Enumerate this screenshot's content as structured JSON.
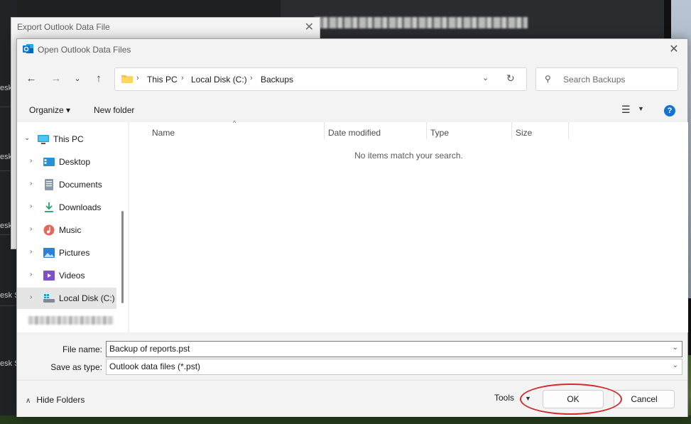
{
  "background": {
    "left_labels": [
      "esk",
      "esk",
      "esk",
      "esk S",
      "esk S"
    ]
  },
  "export_window": {
    "title": "Export Outlook Data File",
    "close_glyph": "✕"
  },
  "dialog": {
    "title": "Open Outlook Data Files",
    "app_icon": "outlook-icon",
    "close_glyph": "✕"
  },
  "nav": {
    "back_glyph": "←",
    "forward_glyph": "→",
    "recent_glyph": "⌄",
    "up_glyph": "↑",
    "breadcrumbs": [
      "This PC",
      "Local Disk (C:)",
      "Backups"
    ],
    "breadcrumb_separator": "›",
    "dropdown_glyph": "⌄",
    "refresh_glyph": "↻"
  },
  "search": {
    "placeholder": "Search Backups",
    "icon_glyph": "⚲"
  },
  "toolbar": {
    "organize_label": "Organize ▾",
    "new_folder_label": "New folder",
    "view_glyph": "☰",
    "view_dropdown_glyph": "▼",
    "help_glyph": "?"
  },
  "tree": {
    "items": [
      {
        "label": "This PC",
        "icon": "computer-icon",
        "expanded": true
      },
      {
        "label": "Desktop",
        "icon": "desktop-icon"
      },
      {
        "label": "Documents",
        "icon": "documents-icon"
      },
      {
        "label": "Downloads",
        "icon": "downloads-icon"
      },
      {
        "label": "Music",
        "icon": "music-icon"
      },
      {
        "label": "Pictures",
        "icon": "pictures-icon"
      },
      {
        "label": "Videos",
        "icon": "videos-icon"
      },
      {
        "label": "Local Disk (C:)",
        "icon": "drive-icon",
        "selected": true
      }
    ],
    "expand_glyph": "›",
    "expanded_glyph": "⌄"
  },
  "columns": [
    "Name",
    "Date modified",
    "Type",
    "Size"
  ],
  "sort_glyph": "^",
  "empty_message": "No items match your search.",
  "file_name": {
    "label": "File name:",
    "value": "Backup of reports.pst"
  },
  "save_as_type": {
    "label": "Save as type:",
    "value": "Outlook data files (*.pst)"
  },
  "field_dropdown_glyph": "⌄",
  "footer": {
    "hide_folders_label": "Hide Folders",
    "hide_glyph": "∧",
    "tools_label": "Tools",
    "tools_dropdown_glyph": "▼",
    "ok_label": "OK",
    "cancel_label": "Cancel"
  },
  "colors": {
    "highlight_ring": "#d42a2a",
    "help_blue": "#1273d6",
    "folder_yellow": "#f4c430"
  }
}
